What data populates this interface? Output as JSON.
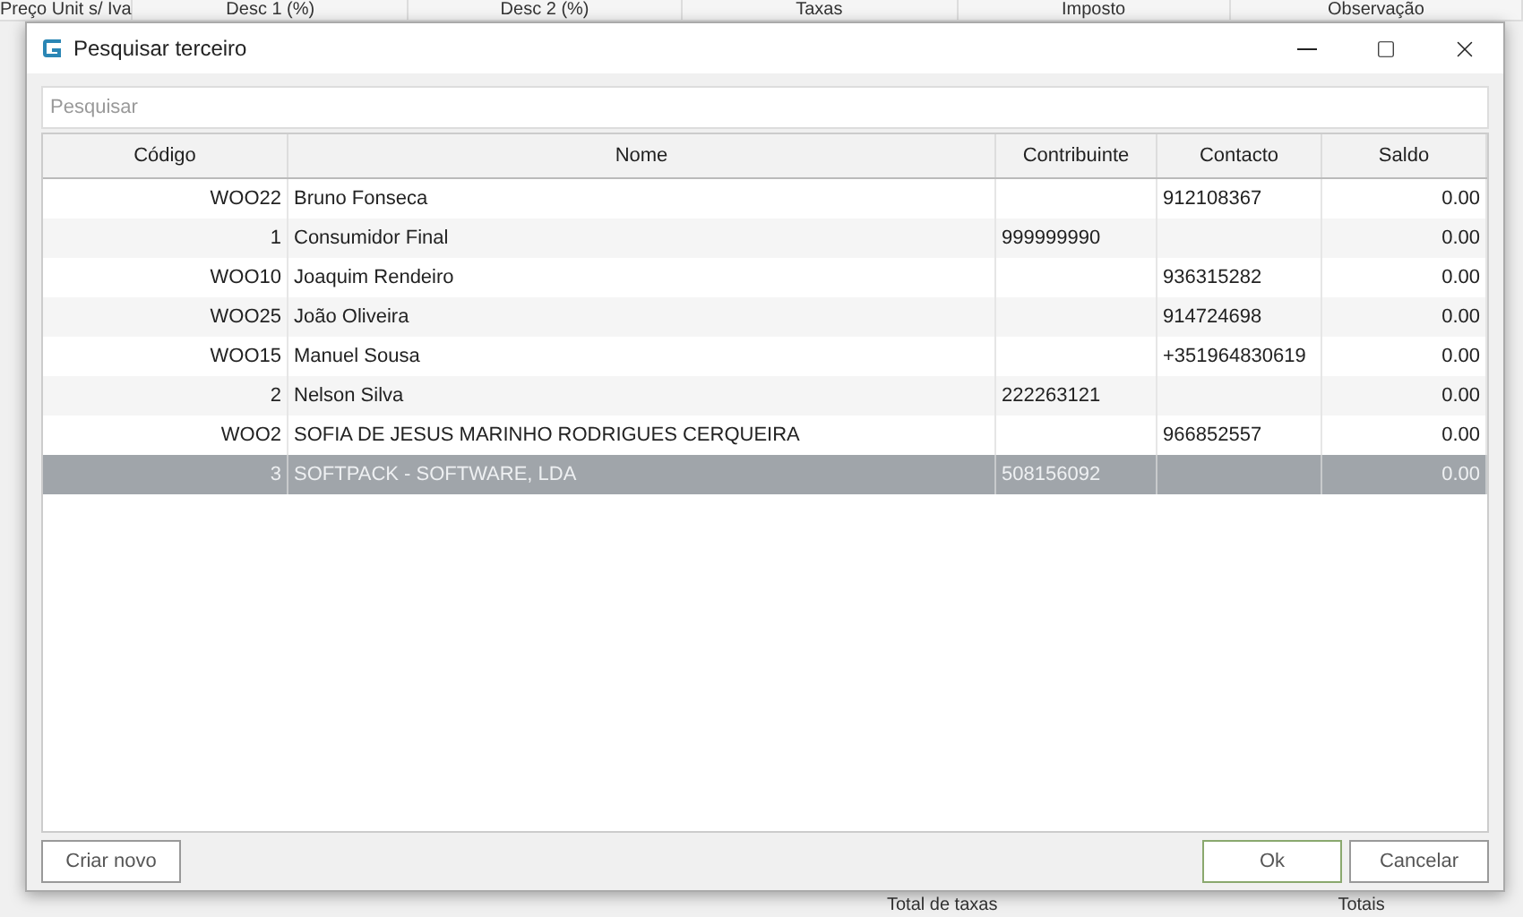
{
  "background": {
    "columns": [
      "Preço Unit s/ Iva",
      "Desc 1 (%)",
      "Desc 2 (%)",
      "Taxas",
      "Imposto",
      "Observação"
    ],
    "footer": [
      "Total de taxas",
      "Totais"
    ]
  },
  "dialog": {
    "title": "Pesquisar terceiro",
    "search": {
      "placeholder": "Pesquisar"
    },
    "table": {
      "columns": [
        "Código",
        "Nome",
        "Contribuinte",
        "Contacto",
        "Saldo"
      ],
      "rows": [
        {
          "codigo": "WOO22",
          "nome": "Bruno Fonseca",
          "contribuinte": "",
          "contacto": "912108367",
          "saldo": "0.00",
          "selected": false
        },
        {
          "codigo": "1",
          "nome": "Consumidor Final",
          "contribuinte": "999999990",
          "contacto": "",
          "saldo": "0.00",
          "selected": false
        },
        {
          "codigo": "WOO10",
          "nome": "Joaquim Rendeiro",
          "contribuinte": "",
          "contacto": "936315282",
          "saldo": "0.00",
          "selected": false
        },
        {
          "codigo": "WOO25",
          "nome": "João Oliveira",
          "contribuinte": "",
          "contacto": "914724698",
          "saldo": "0.00",
          "selected": false
        },
        {
          "codigo": "WOO15",
          "nome": "Manuel Sousa",
          "contribuinte": "",
          "contacto": "+351964830619",
          "saldo": "0.00",
          "selected": false
        },
        {
          "codigo": "2",
          "nome": "Nelson Silva",
          "contribuinte": "222263121",
          "contacto": "",
          "saldo": "0.00",
          "selected": false
        },
        {
          "codigo": "WOO2",
          "nome": "SOFIA DE JESUS MARINHO RODRIGUES CERQUEIRA",
          "contribuinte": "",
          "contacto": "966852557",
          "saldo": "0.00",
          "selected": false
        },
        {
          "codigo": "3",
          "nome": "SOFTPACK - SOFTWARE, LDA",
          "contribuinte": "508156092",
          "contacto": "",
          "saldo": "0.00",
          "selected": true
        }
      ]
    },
    "buttons": {
      "create": "Criar novo",
      "ok": "Ok",
      "cancel": "Cancelar"
    }
  }
}
